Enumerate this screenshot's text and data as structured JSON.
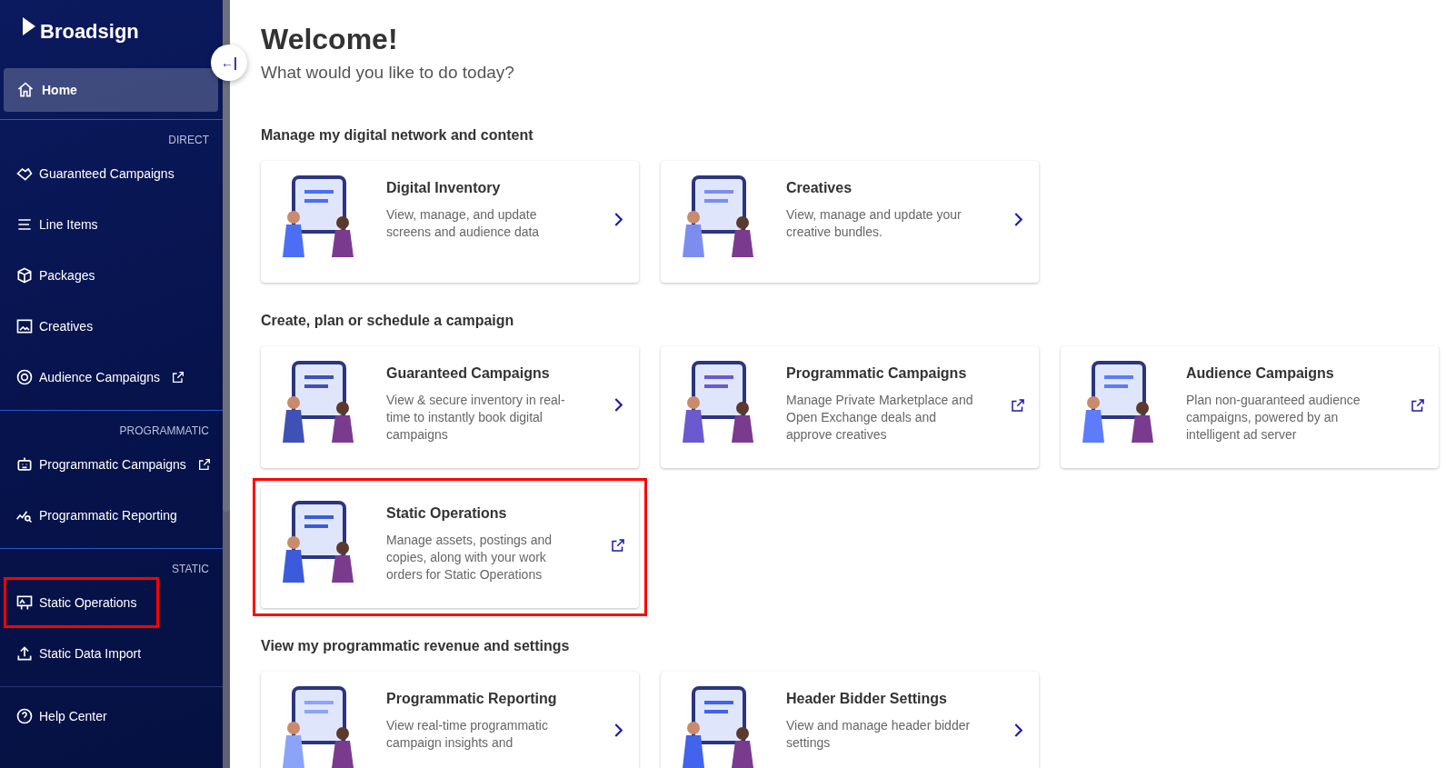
{
  "sidebar": {
    "logo": "Broadsign",
    "collapse_button": "←|",
    "home": {
      "label": "Home",
      "selected": true
    },
    "sections": [
      {
        "heading": "DIRECT",
        "items": [
          {
            "label": "Guaranteed Campaigns",
            "external": false,
            "highlighted": false
          },
          {
            "label": "Line Items",
            "external": false,
            "highlighted": false
          },
          {
            "label": "Packages",
            "external": false,
            "highlighted": false
          },
          {
            "label": "Creatives",
            "external": false,
            "highlighted": false
          },
          {
            "label": "Audience Campaigns",
            "external": true,
            "highlighted": false
          }
        ]
      },
      {
        "heading": "PROGRAMMATIC",
        "items": [
          {
            "label": "Programmatic Campaigns",
            "external": true,
            "highlighted": false
          },
          {
            "label": "Programmatic Reporting",
            "external": false,
            "highlighted": false
          }
        ]
      },
      {
        "heading": "STATIC",
        "items": [
          {
            "label": "Static Operations",
            "external": false,
            "highlighted": true
          },
          {
            "label": "Static Data Import",
            "external": false,
            "highlighted": false
          }
        ]
      }
    ],
    "help": {
      "label": "Help Center"
    }
  },
  "main": {
    "title": "Welcome!",
    "subtitle": "What would you like to do today?",
    "groups": [
      {
        "heading": "Manage my digital network and content",
        "cards": [
          {
            "title": "Digital Inventory",
            "description": "View, manage, and update screens and audience data",
            "external": false,
            "highlighted": false
          },
          {
            "title": "Creatives",
            "description": "View, manage and update your creative bundles.",
            "external": false,
            "highlighted": false
          }
        ]
      },
      {
        "heading": "Create, plan or schedule a campaign",
        "cards": [
          {
            "title": "Guaranteed Campaigns",
            "description": "View & secure inventory in real-time to instantly book digital campaigns",
            "external": false,
            "highlighted": false
          },
          {
            "title": "Programmatic Campaigns",
            "description": "Manage Private Marketplace and Open Exchange deals and approve creatives",
            "external": true,
            "highlighted": false
          },
          {
            "title": "Audience Campaigns",
            "description": "Plan non-guaranteed audience campaigns, powered by an intelligent ad server",
            "external": true,
            "highlighted": false
          },
          {
            "title": "Static Operations",
            "description": "Manage assets, postings and copies, along with your work orders for Static Operations",
            "external": true,
            "highlighted": true
          }
        ]
      },
      {
        "heading": "View my programmatic revenue and settings",
        "cards": [
          {
            "title": "Programmatic Reporting",
            "description": "View real-time programmatic campaign insights and",
            "external": false,
            "highlighted": false
          },
          {
            "title": "Header Bidder Settings",
            "description": "View and manage header bidder settings",
            "external": false,
            "highlighted": false
          }
        ]
      }
    ]
  }
}
